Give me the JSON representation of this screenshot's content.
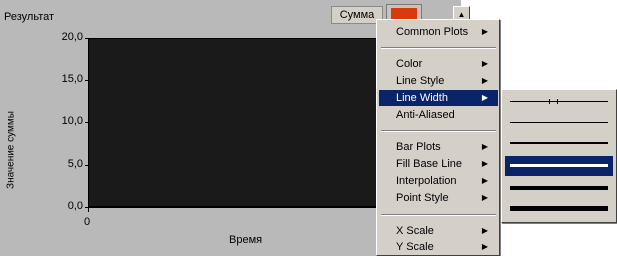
{
  "graph": {
    "title": "Результат",
    "legend_label": "Сумма",
    "y_axis_label": "Значение суммы",
    "y_ticks": [
      "20,0",
      "15,0",
      "10,0",
      "5,0",
      "0,0"
    ],
    "x_ticks": [
      "0"
    ],
    "x_axis_label": "Время",
    "plot_background": "#1a1a1a",
    "legend_swatch_color": "#d83a10",
    "scroll_up_icon": "scroll-up-icon"
  },
  "context_menu": {
    "items": [
      {
        "label": "Common Plots",
        "submenu": true
      },
      {
        "label": "Color",
        "submenu": true
      },
      {
        "label": "Line Style",
        "submenu": true
      },
      {
        "label": "Line Width",
        "submenu": true,
        "highlighted": true
      },
      {
        "label": "Anti-Aliased",
        "submenu": false
      },
      {
        "label": "Bar Plots",
        "submenu": true
      },
      {
        "label": "Fill Base Line",
        "submenu": true
      },
      {
        "label": "Interpolation",
        "submenu": true
      },
      {
        "label": "Point Style",
        "submenu": true
      },
      {
        "label": "X Scale",
        "submenu": true
      },
      {
        "label": "Y Scale",
        "submenu": true
      }
    ],
    "submenu_arrow": "▶",
    "highlight_color": "#0a246a"
  },
  "line_width_submenu": {
    "options": [
      {
        "name": "hairline",
        "selected": false
      },
      {
        "name": "width-1",
        "selected": false
      },
      {
        "name": "width-2",
        "selected": false
      },
      {
        "name": "width-3",
        "selected": true
      },
      {
        "name": "width-4",
        "selected": false
      },
      {
        "name": "width-5",
        "selected": false
      }
    ]
  }
}
